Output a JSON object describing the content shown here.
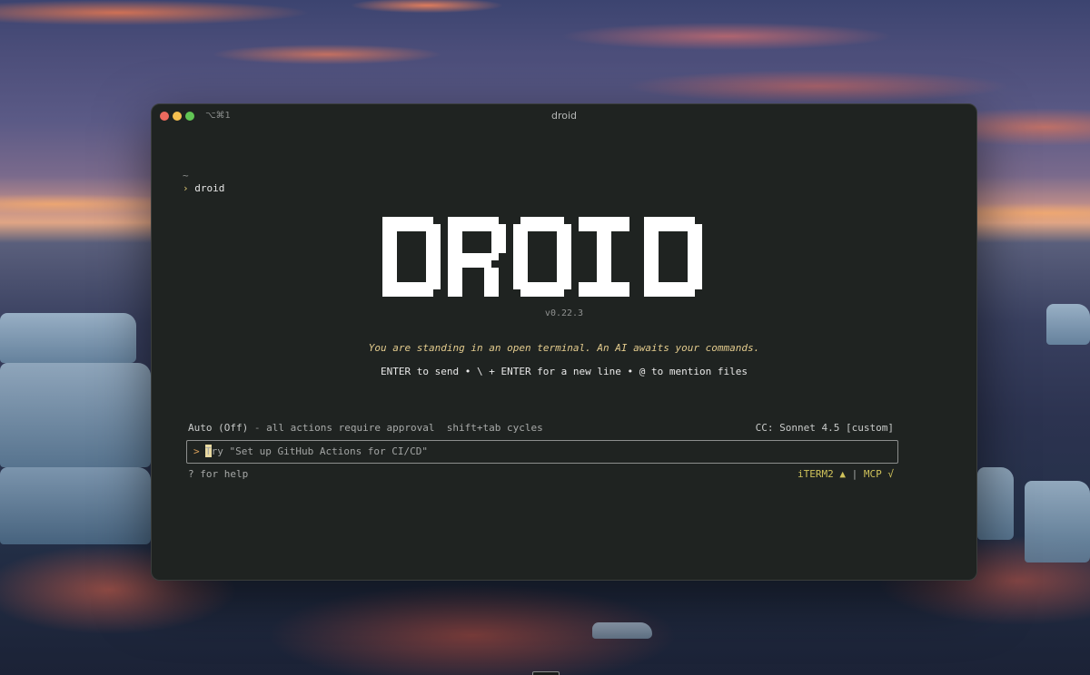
{
  "window": {
    "title": "droid",
    "shortcut": "⌥⌘1"
  },
  "terminal": {
    "cwd": "~",
    "prompt_symbol": "›",
    "command": "droid"
  },
  "app": {
    "logo_text": "DROID",
    "version": "v0.22.3",
    "tagline": "You are standing in an open terminal. An AI awaits your commands.",
    "hint": "ENTER to send • \\ + ENTER for a new line • @ to mention files"
  },
  "status": {
    "mode": "Auto (Off)",
    "mode_separator": "-",
    "mode_description": "all actions require approval",
    "mode_cycle_hint": "shift+tab cycles",
    "model": "CC: Sonnet 4.5 [custom]"
  },
  "input": {
    "caret": ">",
    "placeholder": "Try \"Set up GitHub Actions for CI/CD\""
  },
  "footer": {
    "help": "? for help",
    "terminal_indicator": "iTERM2 ▲",
    "separator": "|",
    "mcp_indicator": "MCP √"
  },
  "colors": {
    "accent": "#e4cc8e",
    "indicator": "#cfc25a",
    "caret": "#d9a05a",
    "terminal_bg": "#1f2321"
  }
}
